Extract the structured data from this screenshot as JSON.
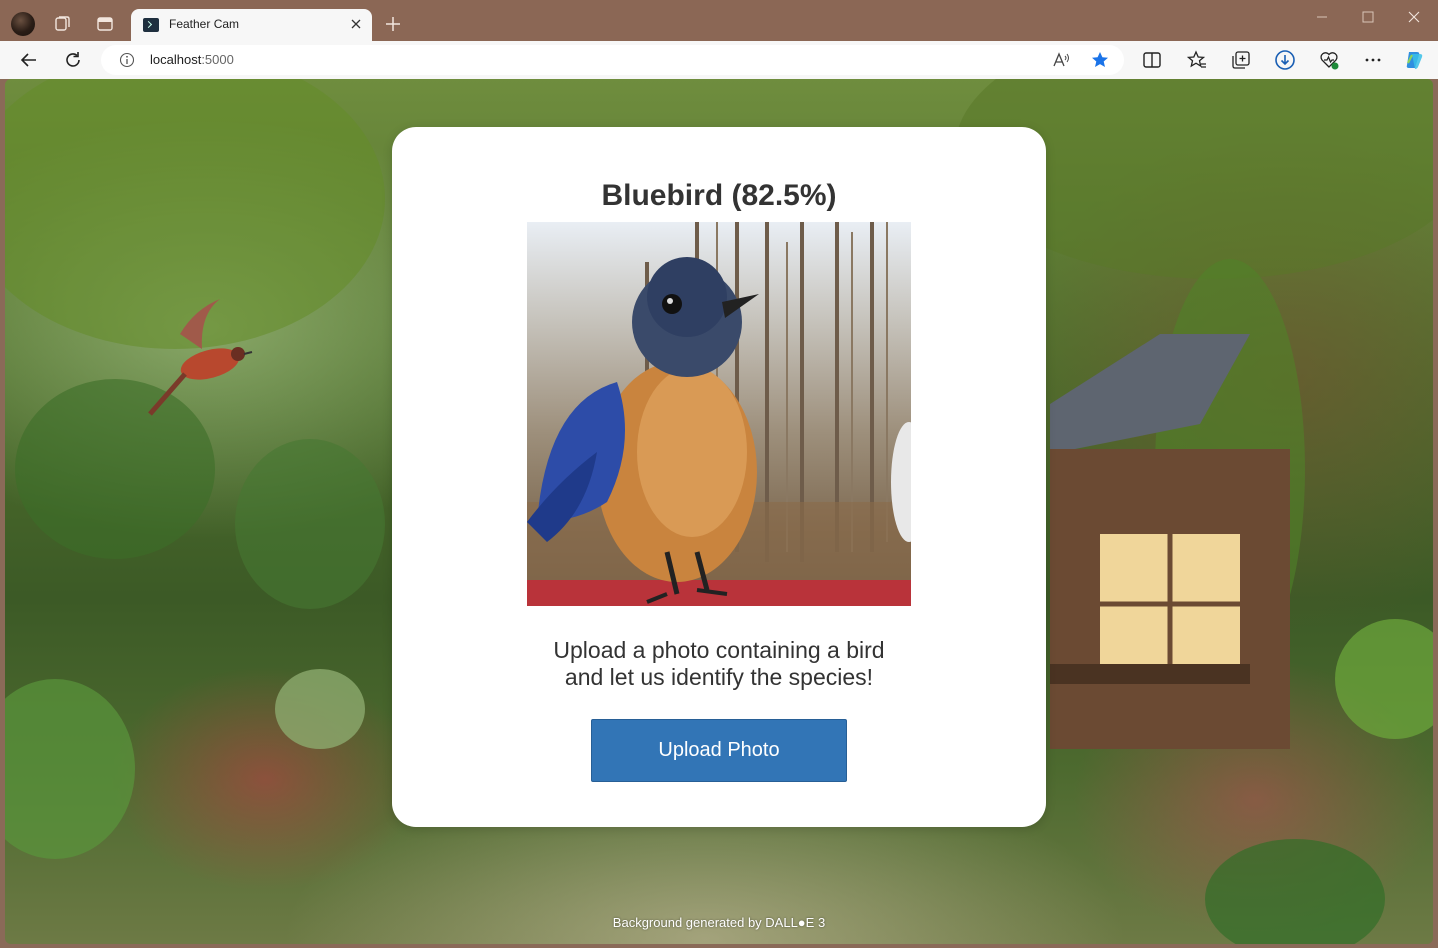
{
  "browser": {
    "tab": {
      "title": "Feather Cam"
    },
    "address_bar": {
      "url_host": "localhost",
      "url_port": ":5000"
    }
  },
  "page": {
    "result_text": "Bluebird (82.5%)",
    "description_line1": "Upload a photo containing a bird",
    "description_line2": "and let us identify the species!",
    "upload_button_label": "Upload Photo",
    "credit_text": "Background generated by DALL●E 3"
  },
  "colors": {
    "titlebar": "#8b6755",
    "button_primary": "#3275b6",
    "favorite_star": "#1a73e8",
    "copilot": "#2f8fe0"
  },
  "icons": [
    "profile-avatar-icon",
    "workspaces-icon",
    "tab-actions-icon",
    "terminal-favicon-icon",
    "close-icon",
    "plus-icon",
    "minimize-icon",
    "maximize-icon",
    "window-close-icon",
    "back-icon",
    "refresh-icon",
    "info-icon",
    "read-aloud-icon",
    "star-icon",
    "split-screen-icon",
    "favorites-icon",
    "collections-icon",
    "download-icon",
    "browser-essentials-icon",
    "more-icon",
    "copilot-icon"
  ]
}
